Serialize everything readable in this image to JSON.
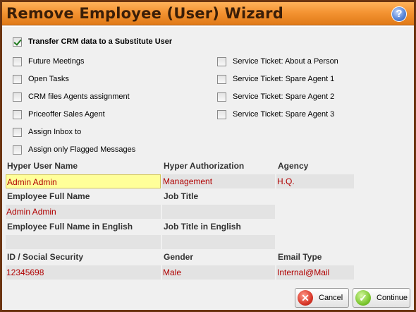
{
  "window": {
    "title": "Remove Employee (User) Wizard",
    "help_icon": "?"
  },
  "transfer": {
    "label": "Transfer CRM data to a Substitute User",
    "checked": true
  },
  "options_left": [
    {
      "label": "Future Meetings",
      "checked": false
    },
    {
      "label": "Open Tasks",
      "checked": false
    },
    {
      "label": "CRM files Agents assignment",
      "checked": false
    },
    {
      "label": "Priceoffer Sales Agent",
      "checked": false
    },
    {
      "label": "Assign Inbox to",
      "checked": false
    },
    {
      "label": "Assign only Flagged Messages",
      "checked": false
    }
  ],
  "options_right": [
    {
      "label": "Service Ticket: About a Person",
      "checked": false
    },
    {
      "label": "Service Ticket: Spare Agent 1",
      "checked": false
    },
    {
      "label": "Service Ticket: Spare Agent 2",
      "checked": false
    },
    {
      "label": "Service Ticket: Spare Agent 3",
      "checked": false
    }
  ],
  "fields": {
    "hyper_user_name": {
      "label": "Hyper User Name",
      "value": "Admin Admin"
    },
    "hyper_authorization": {
      "label": "Hyper Authorization",
      "value": "Management"
    },
    "agency": {
      "label": "Agency",
      "value": "H.Q."
    },
    "employee_full_name": {
      "label": "Employee Full Name",
      "value": "Admin Admin"
    },
    "job_title": {
      "label": "Job Title",
      "value": ""
    },
    "employee_full_name_en": {
      "label": "Employee Full Name in English",
      "value": ""
    },
    "job_title_en": {
      "label": "Job Title in English",
      "value": ""
    },
    "id_social": {
      "label": "ID / Social Security",
      "value": "12345698"
    },
    "gender": {
      "label": "Gender",
      "value": "Male"
    },
    "email_type": {
      "label": "Email Type",
      "value": "Internal@Mail"
    }
  },
  "buttons": {
    "cancel": "Cancel",
    "continue": "Continue"
  },
  "colors": {
    "title_bar": "#f49433",
    "value_text": "#b00000",
    "highlight_field": "#ffff99",
    "frame": "#6b3410"
  }
}
